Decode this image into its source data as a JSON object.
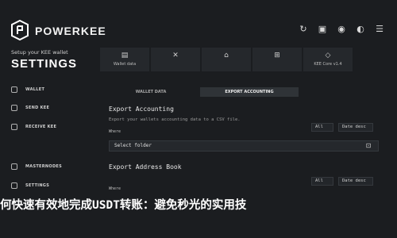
{
  "app": {
    "name": "POWERKEE",
    "subtitle": "Setup your KEE wallet",
    "title": "SETTINGS"
  },
  "header_icons": [
    "refresh-icon",
    "gift-icon",
    "palette-icon",
    "contrast-icon",
    "menu-icon"
  ],
  "sidebar": {
    "items": [
      {
        "label": "WALLET",
        "icon": "wallet-icon"
      },
      {
        "label": "SEND KEE",
        "icon": "send-icon"
      },
      {
        "label": "RECEIVE KEE",
        "icon": "receive-icon"
      },
      {
        "label": "MASTERNODES",
        "icon": "masternodes-icon"
      },
      {
        "label": "SETTINGS",
        "icon": "settings-icon"
      }
    ]
  },
  "tabs": [
    {
      "label": "Wallet data",
      "icon": "wallet-data-icon"
    },
    {
      "label": "",
      "icon": "tools-icon"
    },
    {
      "label": "",
      "icon": "network-icon"
    },
    {
      "label": "",
      "icon": "currency-icon"
    },
    {
      "label": "KEE Core v1.4",
      "icon": "core-icon"
    }
  ],
  "subtabs": [
    {
      "label": "WALLET DATA",
      "active": false
    },
    {
      "label": "EXPORT ACCOUNTING",
      "active": true
    },
    {
      "label": "",
      "active": false
    }
  ],
  "export_accounting": {
    "title": "Export Accounting",
    "desc": "Export your wallets accounting data to a CSV file.",
    "where_label": "Where",
    "filter_all": "All",
    "filter_date": "Date desc",
    "select_folder": "Select folder"
  },
  "export_address": {
    "title": "Export Address Book",
    "where_label": "Where",
    "filter_all": "All",
    "filter_date": "Date desc"
  },
  "banner_text": "何快速有效地完成USDT转账：避免秒光的实用技"
}
